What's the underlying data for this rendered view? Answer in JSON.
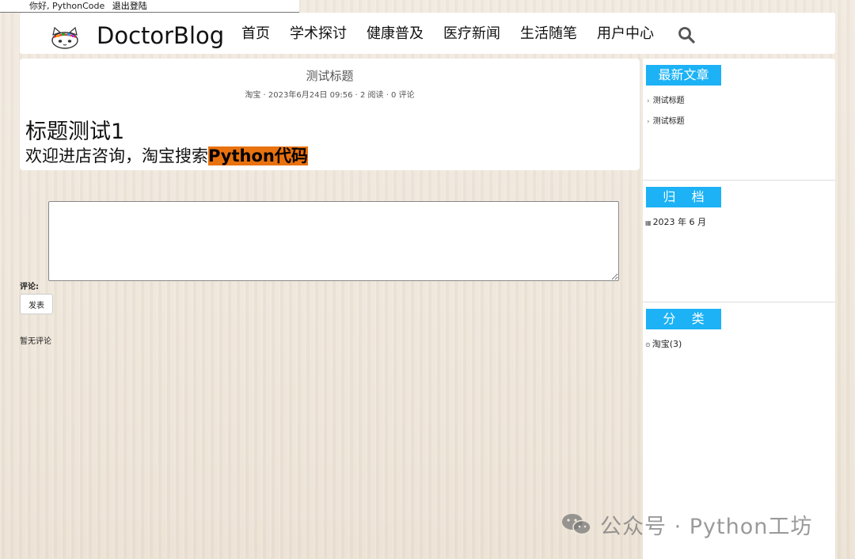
{
  "userbar": {
    "greeting": "你好, PythonCode",
    "logout_label": "退出登陆"
  },
  "header": {
    "brand": "DoctorBlog",
    "nav": [
      "首页",
      "学术探讨",
      "健康普及",
      "医疗新闻",
      "生活随笔",
      "用户中心"
    ],
    "search_icon": "search-icon"
  },
  "article": {
    "title": "测试标题",
    "meta": "淘宝 · 2023年6月24日 09:56 · 2 阅读 · 0 评论",
    "heading": "标题测试1",
    "content_prefix": "欢迎进店咨询，淘宝搜索",
    "content_highlight": "Python代码",
    "highlight_color": "#e8720f"
  },
  "comment": {
    "input_value": "",
    "label": "评论:",
    "submit_label": "发表",
    "empty_text": "暂无评论"
  },
  "sidebar": {
    "accent_color": "#1cb2f5",
    "recent": {
      "title": "最新文章",
      "items": [
        "测试标题",
        "测试标题"
      ]
    },
    "archive": {
      "title": "归    档",
      "items": [
        "2023 年 6 月"
      ]
    },
    "category": {
      "title": "分    类",
      "items": [
        "淘宝(3)"
      ]
    }
  },
  "watermark": {
    "text": "公众号 · Python工坊"
  }
}
